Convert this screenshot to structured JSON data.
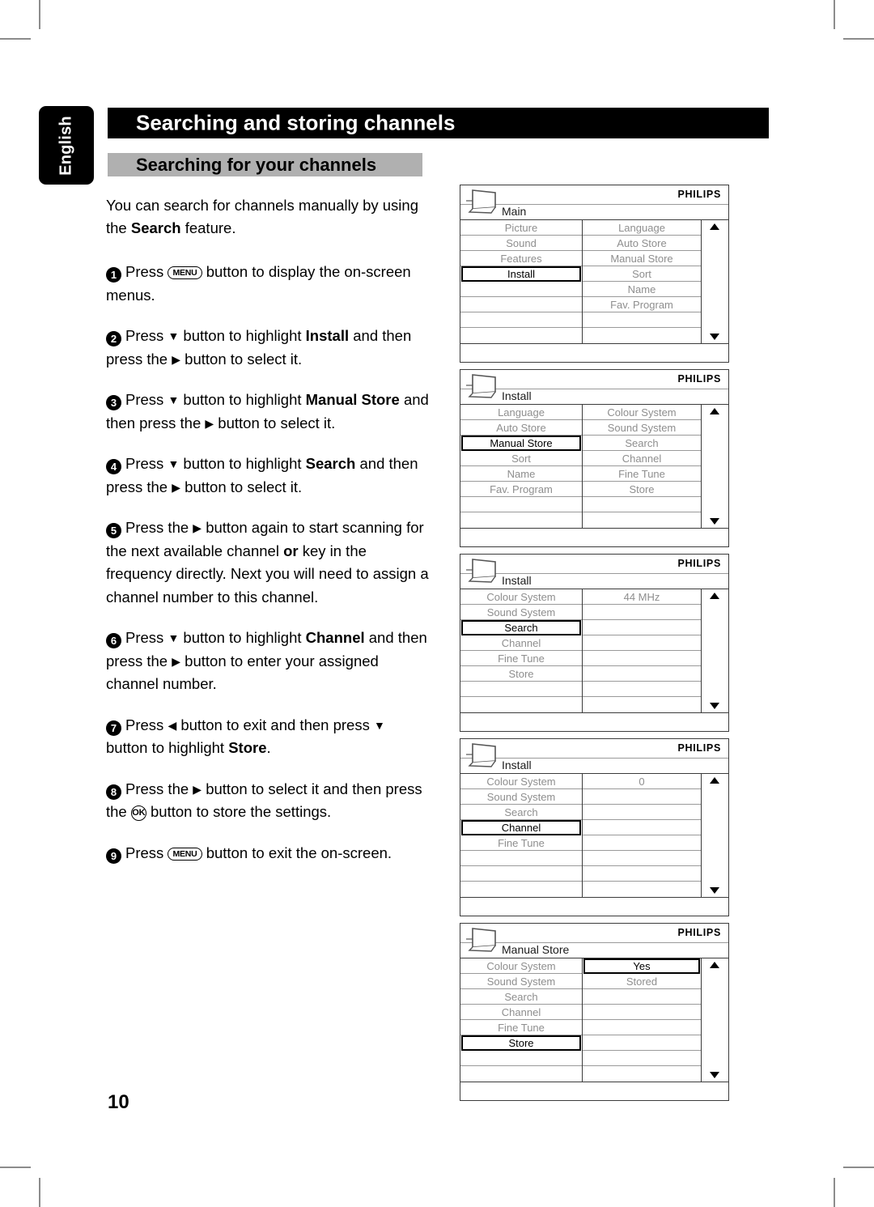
{
  "language_tab": "English",
  "header": {
    "title": "Searching and storing channels",
    "section_title": "Searching for your channels"
  },
  "page_number": "10",
  "intro": {
    "line_a": "You can search for channels manually by using the ",
    "bold": "Search",
    "line_b": " feature."
  },
  "steps": [
    {
      "num": "1",
      "parts": [
        {
          "t": "Press  ",
          "s": "n"
        },
        {
          "t": "MENU",
          "s": "key"
        },
        {
          "t": "  button to display the on-screen menus.",
          "s": "n"
        }
      ]
    },
    {
      "num": "2",
      "parts": [
        {
          "t": "Press ",
          "s": "n"
        },
        {
          "t": "▼",
          "s": "arrow"
        },
        {
          "t": " button to highlight ",
          "s": "n"
        },
        {
          "t": "Install",
          "s": "b"
        },
        {
          "t": " and then press the ",
          "s": "n"
        },
        {
          "t": "▶",
          "s": "arrow"
        },
        {
          "t": " button to select it.",
          "s": "n"
        }
      ]
    },
    {
      "num": "3",
      "parts": [
        {
          "t": "Press ",
          "s": "n"
        },
        {
          "t": "▼",
          "s": "arrow"
        },
        {
          "t": " button to highlight ",
          "s": "n"
        },
        {
          "t": "Manual Store",
          "s": "b"
        },
        {
          "t": " and then press the ",
          "s": "n"
        },
        {
          "t": "▶",
          "s": "arrow"
        },
        {
          "t": " button to select it.",
          "s": "n"
        }
      ]
    },
    {
      "num": "4",
      "parts": [
        {
          "t": "Press ",
          "s": "n"
        },
        {
          "t": "▼",
          "s": "arrow"
        },
        {
          "t": " button to highlight ",
          "s": "n"
        },
        {
          "t": "Search",
          "s": "b"
        },
        {
          "t": " and then press the ",
          "s": "n"
        },
        {
          "t": "▶",
          "s": "arrow"
        },
        {
          "t": " button to select it.",
          "s": "n"
        }
      ]
    },
    {
      "num": "5",
      "parts": [
        {
          "t": "Press the ",
          "s": "n"
        },
        {
          "t": "▶",
          "s": "arrow"
        },
        {
          "t": " button again to start scanning for the next available channel ",
          "s": "n"
        },
        {
          "t": "or",
          "s": "b"
        },
        {
          "t": " key in the frequency directly. Next you will need to assign a channel number to this channel.",
          "s": "n"
        }
      ]
    },
    {
      "num": "6",
      "parts": [
        {
          "t": "Press ",
          "s": "n"
        },
        {
          "t": "▼",
          "s": "arrow"
        },
        {
          "t": " button to highlight ",
          "s": "n"
        },
        {
          "t": "Channel",
          "s": "b"
        },
        {
          "t": " and then press the ",
          "s": "n"
        },
        {
          "t": "▶",
          "s": "arrow"
        },
        {
          "t": " button to enter your assigned channel number.",
          "s": "n"
        }
      ]
    },
    {
      "num": "7",
      "parts": [
        {
          "t": "Press ",
          "s": "n"
        },
        {
          "t": "◀",
          "s": "arrow"
        },
        {
          "t": " button to exit and then press ",
          "s": "n"
        },
        {
          "t": "▼",
          "s": "arrow"
        },
        {
          "t": " button to highlight ",
          "s": "n"
        },
        {
          "t": "Store",
          "s": "b"
        },
        {
          "t": ".",
          "s": "n"
        }
      ]
    },
    {
      "num": "8",
      "parts": [
        {
          "t": "Press the ",
          "s": "n"
        },
        {
          "t": "▶",
          "s": "arrow"
        },
        {
          "t": " button to select it and then press the ",
          "s": "n"
        },
        {
          "t": "OK",
          "s": "keyround"
        },
        {
          "t": " button to store the settings.",
          "s": "n"
        }
      ]
    },
    {
      "num": "9",
      "parts": [
        {
          "t": "Press  ",
          "s": "n"
        },
        {
          "t": "MENU",
          "s": "key"
        },
        {
          "t": "  button to exit the on-screen.",
          "s": "n"
        }
      ]
    }
  ],
  "osd_panels": [
    {
      "brand": "PHILIPS",
      "title": "Main",
      "left_column": [
        {
          "label": "Picture",
          "selected": false
        },
        {
          "label": "Sound",
          "selected": false
        },
        {
          "label": "Features",
          "selected": false
        },
        {
          "label": "Install",
          "selected": true
        },
        {
          "label": "",
          "selected": false
        },
        {
          "label": "",
          "selected": false
        },
        {
          "label": "",
          "selected": false
        },
        {
          "label": "",
          "selected": false
        }
      ],
      "right_column": [
        {
          "label": "Language",
          "selected": false
        },
        {
          "label": "Auto Store",
          "selected": false
        },
        {
          "label": "Manual Store",
          "selected": false
        },
        {
          "label": "Sort",
          "selected": false
        },
        {
          "label": "Name",
          "selected": false
        },
        {
          "label": "Fav. Program",
          "selected": false
        },
        {
          "label": "",
          "selected": false
        },
        {
          "label": "",
          "selected": false
        }
      ]
    },
    {
      "brand": "PHILIPS",
      "title": "Install",
      "left_column": [
        {
          "label": "Language",
          "selected": false
        },
        {
          "label": "Auto Store",
          "selected": false
        },
        {
          "label": "Manual Store",
          "selected": true
        },
        {
          "label": "Sort",
          "selected": false
        },
        {
          "label": "Name",
          "selected": false
        },
        {
          "label": "Fav. Program",
          "selected": false
        },
        {
          "label": "",
          "selected": false
        },
        {
          "label": "",
          "selected": false
        }
      ],
      "right_column": [
        {
          "label": "Colour System",
          "selected": false
        },
        {
          "label": "Sound System",
          "selected": false
        },
        {
          "label": "Search",
          "selected": false
        },
        {
          "label": "Channel",
          "selected": false
        },
        {
          "label": "Fine Tune",
          "selected": false
        },
        {
          "label": "Store",
          "selected": false
        },
        {
          "label": "",
          "selected": false
        },
        {
          "label": "",
          "selected": false
        }
      ]
    },
    {
      "brand": "PHILIPS",
      "title": "Install",
      "left_column": [
        {
          "label": "Colour System",
          "selected": false
        },
        {
          "label": "Sound System",
          "selected": false
        },
        {
          "label": "Search",
          "selected": true
        },
        {
          "label": "Channel",
          "selected": false
        },
        {
          "label": "Fine Tune",
          "selected": false
        },
        {
          "label": "Store",
          "selected": false
        },
        {
          "label": "",
          "selected": false
        },
        {
          "label": "",
          "selected": false
        }
      ],
      "right_column": [
        {
          "label": "44 MHz",
          "selected": false
        },
        {
          "label": "",
          "selected": false
        },
        {
          "label": "",
          "selected": false
        },
        {
          "label": "",
          "selected": false
        },
        {
          "label": "",
          "selected": false
        },
        {
          "label": "",
          "selected": false
        },
        {
          "label": "",
          "selected": false
        },
        {
          "label": "",
          "selected": false
        }
      ]
    },
    {
      "brand": "PHILIPS",
      "title": "Install",
      "left_column": [
        {
          "label": "Colour System",
          "selected": false
        },
        {
          "label": "Sound System",
          "selected": false
        },
        {
          "label": "Search",
          "selected": false
        },
        {
          "label": "Channel",
          "selected": true
        },
        {
          "label": "Fine Tune",
          "selected": false
        },
        {
          "label": "",
          "selected": false
        },
        {
          "label": "",
          "selected": false
        },
        {
          "label": "",
          "selected": false
        }
      ],
      "right_column": [
        {
          "label": "0",
          "selected": false
        },
        {
          "label": "",
          "selected": false
        },
        {
          "label": "",
          "selected": false
        },
        {
          "label": "",
          "selected": false
        },
        {
          "label": "",
          "selected": false
        },
        {
          "label": "",
          "selected": false
        },
        {
          "label": "",
          "selected": false
        },
        {
          "label": "",
          "selected": false
        }
      ]
    },
    {
      "brand": "PHILIPS",
      "title": "Manual Store",
      "left_column": [
        {
          "label": "Colour System",
          "selected": false
        },
        {
          "label": "Sound System",
          "selected": false
        },
        {
          "label": "Search",
          "selected": false
        },
        {
          "label": "Channel",
          "selected": false
        },
        {
          "label": "Fine Tune",
          "selected": false
        },
        {
          "label": "Store",
          "selected": true
        },
        {
          "label": "",
          "selected": false
        },
        {
          "label": "",
          "selected": false
        }
      ],
      "right_column": [
        {
          "label": "Yes",
          "selected": true
        },
        {
          "label": "Stored",
          "selected": false
        },
        {
          "label": "",
          "selected": false
        },
        {
          "label": "",
          "selected": false
        },
        {
          "label": "",
          "selected": false
        },
        {
          "label": "",
          "selected": false
        },
        {
          "label": "",
          "selected": false
        },
        {
          "label": "",
          "selected": false
        }
      ]
    }
  ],
  "osd_panel_tops": [
    228,
    456,
    684,
    912,
    1140
  ]
}
